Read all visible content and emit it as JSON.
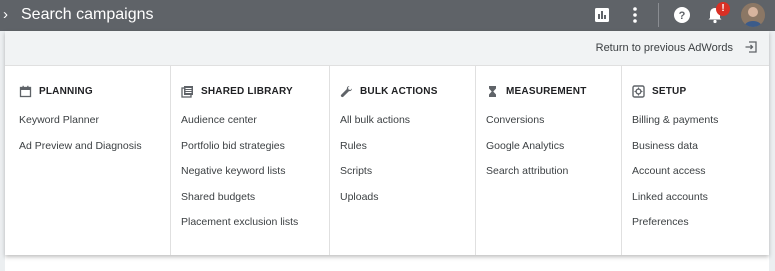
{
  "header": {
    "search_label": "Search campaigns",
    "notification_count": "!"
  },
  "panel": {
    "return_link": "Return to previous AdWords"
  },
  "columns": [
    {
      "title": "PLANNING",
      "icon": "calendar-icon",
      "items": [
        "Keyword Planner",
        "Ad Preview and Diagnosis"
      ]
    },
    {
      "title": "SHARED LIBRARY",
      "icon": "library-icon",
      "items": [
        "Audience center",
        "Portfolio bid strategies",
        "Negative keyword lists",
        "Shared budgets",
        "Placement exclusion lists"
      ]
    },
    {
      "title": "BULK ACTIONS",
      "icon": "wrench-icon",
      "items": [
        "All bulk actions",
        "Rules",
        "Scripts",
        "Uploads"
      ]
    },
    {
      "title": "MEASUREMENT",
      "icon": "hourglass-icon",
      "items": [
        "Conversions",
        "Google Analytics",
        "Search attribution"
      ]
    },
    {
      "title": "SETUP",
      "icon": "settings-box-icon",
      "items": [
        "Billing & payments",
        "Business data",
        "Account access",
        "Linked accounts",
        "Preferences"
      ]
    }
  ],
  "colors": {
    "topbar": "#5f6368",
    "panel_header": "#f1f3f4",
    "badge": "#d93025"
  }
}
